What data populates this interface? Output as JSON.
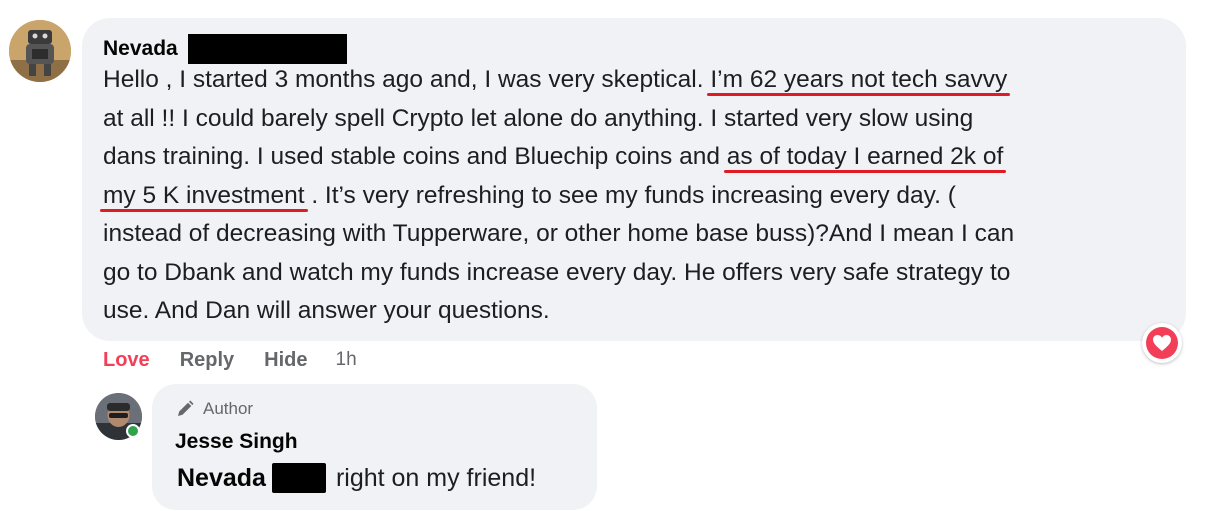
{
  "comment": {
    "author": "Nevada",
    "lines": [
      "Hello , I started 3 months ago and, I was very skeptical. ",
      "I’m 62 years not tech savvy",
      "at all !! I could barely spell Crypto let alone do anything. I started very slow using",
      "dans training. I used stable coins and Bluechip coins and ",
      "as of today I earned 2k of",
      "my 5 K investment",
      " . It’s very refreshing to see my funds increasing every day. (",
      "instead of decreasing with Tupperware, or other home base buss)?And I mean I can",
      "go to Dbank and watch my funds increase every day. He offers very safe strategy to",
      "use. And Dan will answer your questions."
    ],
    "reaction_icon": "heart-icon",
    "reaction_color": "#f33e58",
    "highlight_color": "#e01b24"
  },
  "actions": {
    "love": "Love",
    "reply": "Reply",
    "hide": "Hide",
    "time": "1h"
  },
  "reply": {
    "badge": "Author",
    "badge_icon": "pen-icon",
    "author": "Jesse Singh",
    "mention": "Nevada",
    "text": "right on my friend!"
  }
}
